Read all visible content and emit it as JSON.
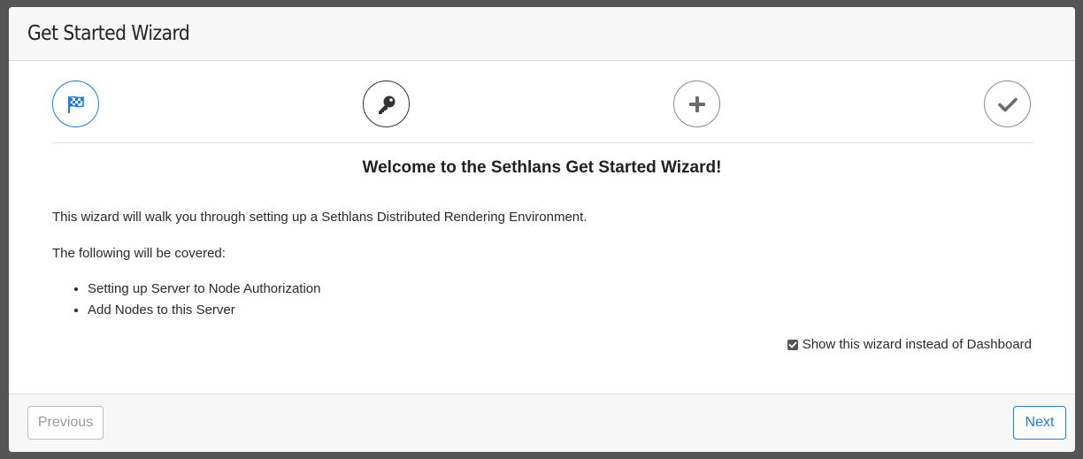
{
  "modal": {
    "title": "Get Started Wizard"
  },
  "steps": [
    {
      "icon": "flag-checkered-icon",
      "state": "active"
    },
    {
      "icon": "key-icon",
      "state": "current"
    },
    {
      "icon": "plus-icon",
      "state": "pending"
    },
    {
      "icon": "check-icon",
      "state": "pending"
    }
  ],
  "content": {
    "heading": "Welcome to the Sethlans Get Started Wizard!",
    "intro": "This wizard will walk you through setting up a Sethlans Distributed Rendering Environment.",
    "covered_label": "The following will be covered:",
    "items": [
      "Setting up Server to Node Authorization",
      "Add Nodes to this Server"
    ],
    "show_wizard_label": "Show this wizard instead of Dashboard",
    "show_wizard_checked": true
  },
  "footer": {
    "previous_label": "Previous",
    "next_label": "Next"
  },
  "colors": {
    "accent": "#1a7fe0",
    "backdrop": "#555555",
    "header_bg": "#f7f7f7"
  }
}
